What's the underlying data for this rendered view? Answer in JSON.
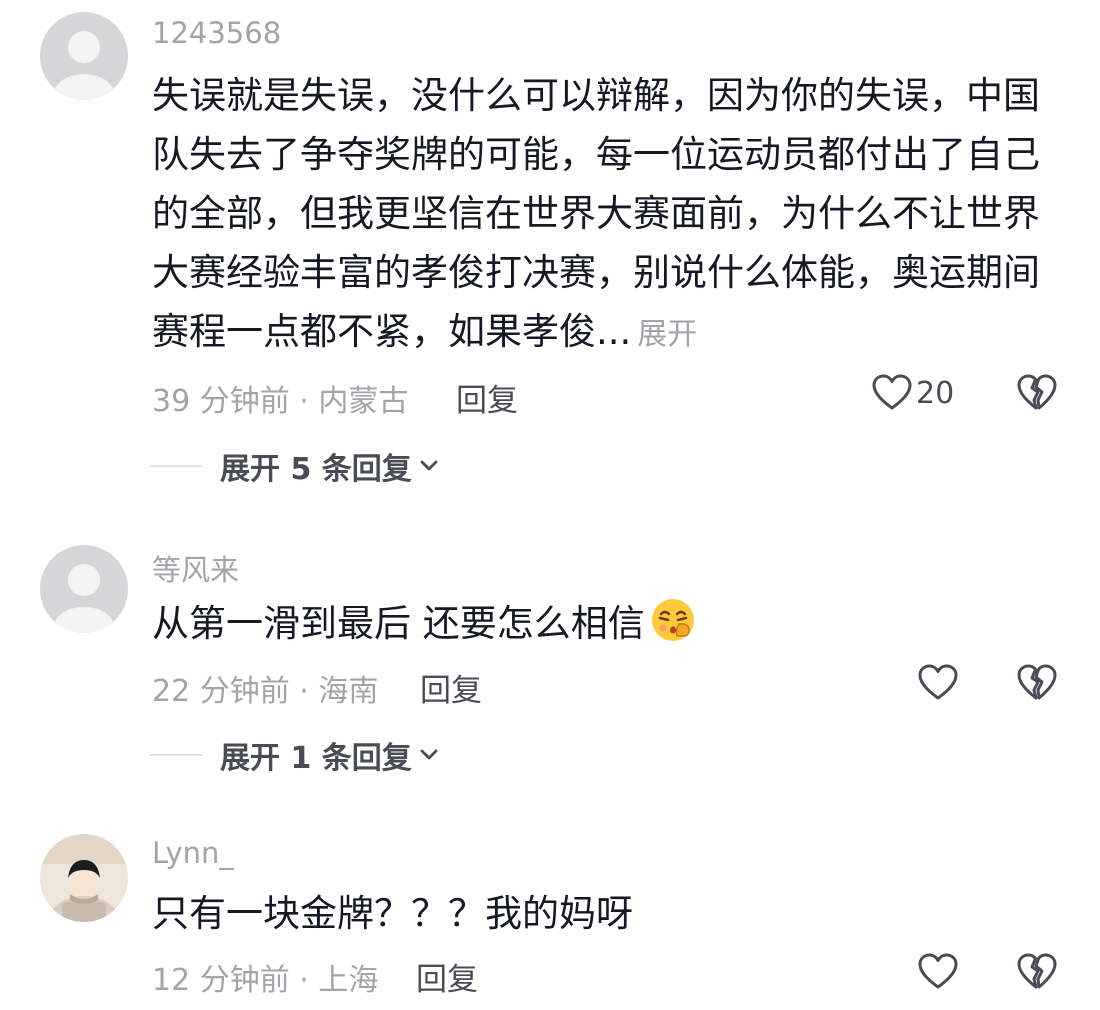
{
  "comments": [
    {
      "username": "1243568",
      "text_lines": [
        "失误就是失误，没什么可以辩解，因为你的失误，中国",
        "队失去了争夺奖牌的可能，每一位运动员都付出了自己",
        "的全部，但我更坚信在世界大赛面前，为什么不让世界",
        "大赛经验丰富的孝俊打决赛，别说什么体能，奥运期间",
        "赛程一点都不紧，如果孝俊..."
      ],
      "expand_text": "展开",
      "time": "39 分钟前",
      "location": "内蒙古",
      "reply_label": "回复",
      "like_count": "20",
      "expand_replies": "展开 5 条回复",
      "avatar_icon": "default-avatar-icon"
    },
    {
      "username": "等风来",
      "text_lines": [
        "从第一滑到最后 还要怎么相信"
      ],
      "emoji": "shushing-face-emoji",
      "time": "22 分钟前",
      "location": "海南",
      "reply_label": "回复",
      "like_count": "",
      "expand_replies": "展开 1 条回复",
      "avatar_icon": "default-avatar-icon"
    },
    {
      "username": "Lynn_",
      "text_lines": [
        "只有一块金牌？？？我的妈呀"
      ],
      "time": "12 分钟前",
      "location": "上海",
      "reply_label": "回复",
      "like_count": "",
      "avatar_icon": "user-photo-avatar"
    }
  ],
  "separator": " · ",
  "colors": {
    "text": "#161823",
    "secondary": "#a3a4a8",
    "action": "#4a4c55",
    "avatar_bg": "#d4d4d6"
  }
}
